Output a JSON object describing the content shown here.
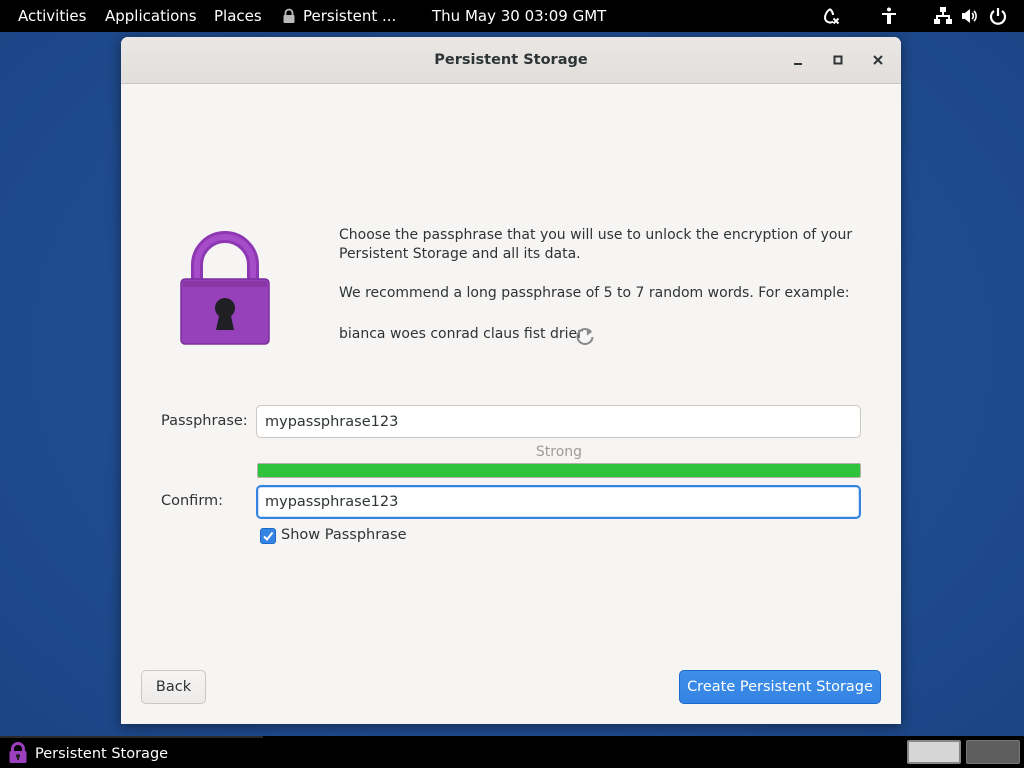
{
  "topbar": {
    "activities": "Activities",
    "applications": "Applications",
    "places": "Places",
    "app_menu": "Persistent ...",
    "clock": "Thu May 30  03:09 GMT",
    "icons": [
      "onion-circuit-icon",
      "accessibility-icon",
      "network-icon",
      "volume-icon",
      "power-icon"
    ]
  },
  "window": {
    "title": "Persistent Storage",
    "intro_line1": "Choose the passphrase that you will use to unlock the encryption of your",
    "intro_line2": "Persistent Storage and all its data.",
    "recommend": "We recommend a long passphrase of 5 to 7 random words. For example:",
    "example_passphrase": "bianca woes conrad claus fist drier",
    "passphrase_label": "Passphrase:",
    "passphrase_value": "mypassphrase123",
    "strength_label": "Strong",
    "strength_fraction": 1.0,
    "confirm_label": "Confirm:",
    "confirm_value": "mypassphrase123",
    "show_passphrase_label": "Show Passphrase",
    "show_passphrase_checked": true,
    "back_label": "Back",
    "create_label": "Create Persistent Storage"
  },
  "taskbar": {
    "task_label": "Persistent Storage"
  },
  "colors": {
    "accent": "#3584e4",
    "strength_bar": "#2ec33a",
    "lock": "#9b3fbf",
    "desktop": "#1f4a8c"
  }
}
